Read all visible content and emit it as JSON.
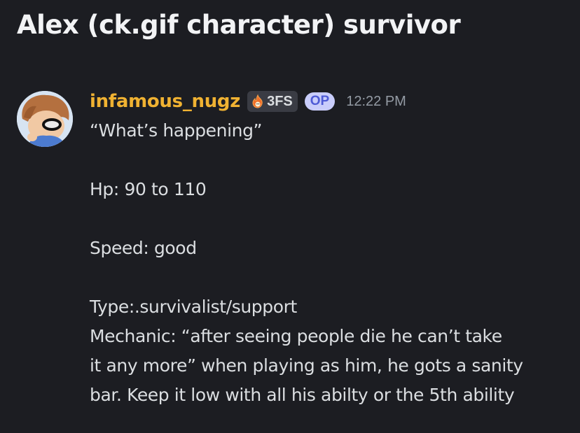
{
  "post": {
    "title": "Alex (ck.gif character) survivor"
  },
  "message": {
    "author": {
      "username": "infamous_nugz",
      "avatar_icon": "avatar-image",
      "tag_icon": "flame-icon",
      "tag_label": "3FS",
      "op_badge": "OP"
    },
    "timestamp": "12:22 PM",
    "lines": [
      "“What’s happening”",
      "",
      "Hp: 90 to 110",
      "",
      "Speed: good",
      "",
      "Type:.survivalist/support",
      "Mechanic: “after seeing people die he can’t take",
      "it any more” when playing as him, he gots a sanity",
      "bar. Keep it low with all his abilty or the 5th ability"
    ]
  },
  "colors": {
    "background": "#1c1d22",
    "username": "#f0b232",
    "text": "#dbdee1",
    "timestamp": "#949ba4",
    "op_badge_bg": "#c9cdfb",
    "op_badge_text": "#4e5bd6"
  }
}
